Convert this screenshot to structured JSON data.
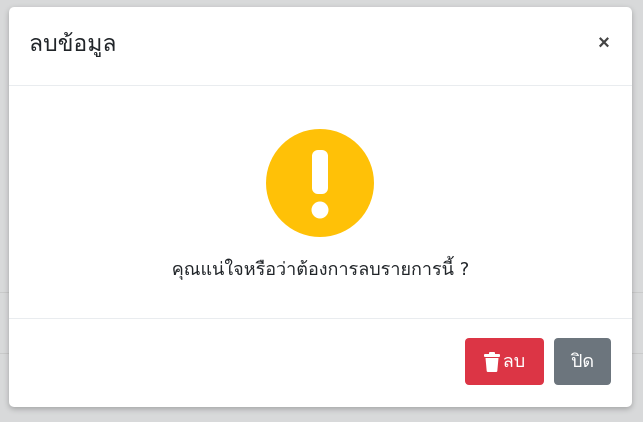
{
  "modal": {
    "title": "ลบข้อมูล",
    "close_symbol": "×",
    "message": "คุณแน่ใจหรือว่าต้องการลบรายการนี้ ?",
    "icon": "exclamation-circle-icon",
    "icon_color": "#ffc107"
  },
  "footer": {
    "delete_label": "ลบ",
    "delete_icon": "trash-icon",
    "delete_color": "#dc3545",
    "close_label": "ปิด",
    "close_color": "#6c757d"
  }
}
